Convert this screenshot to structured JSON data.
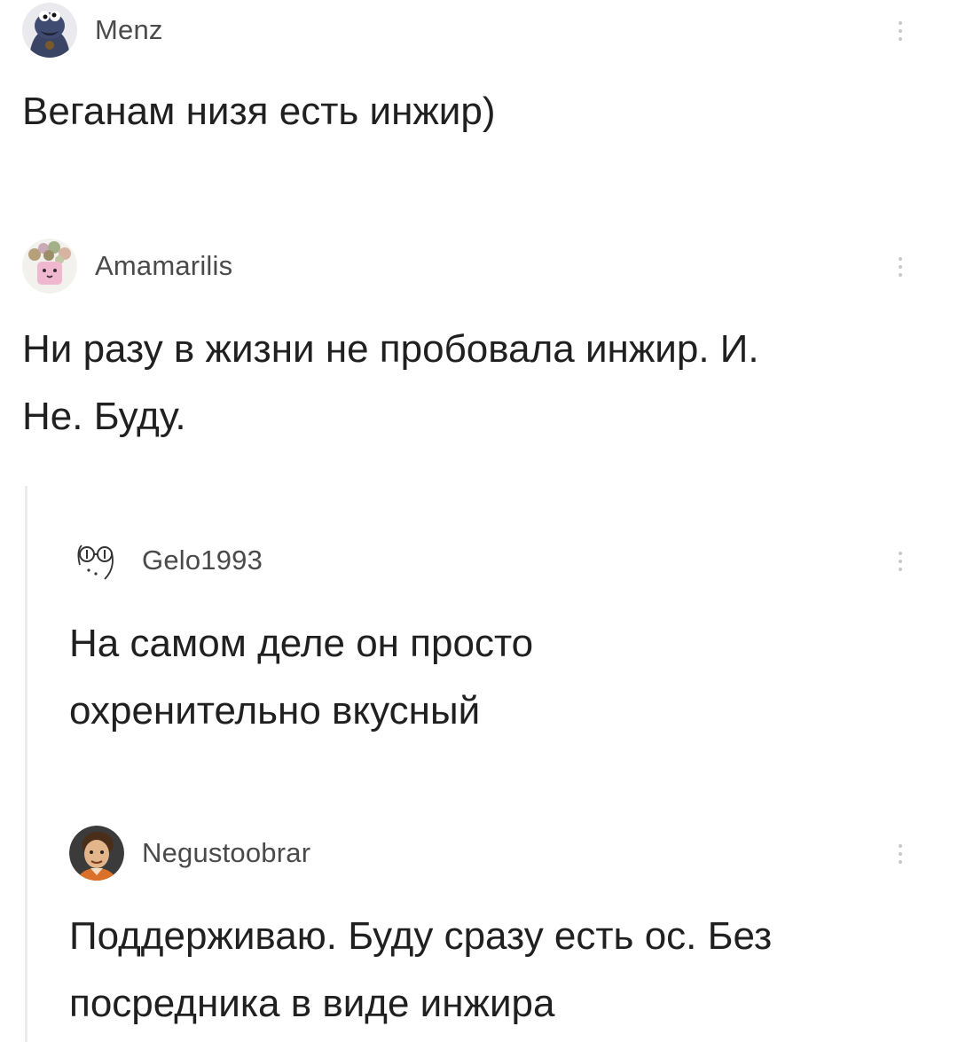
{
  "comments": [
    {
      "username": "Menz",
      "avatar_icon": "cookie-monster-avatar",
      "text": "Веганам низя есть инжир)"
    },
    {
      "username": "Amamarilis",
      "avatar_icon": "flower-cup-avatar",
      "text": "Ни разу в жизни не пробовала инжир. И.\nНе. Буду."
    },
    {
      "username": "Gelo1993",
      "avatar_icon": "glasses-face-avatar",
      "text": "На самом деле он просто\nохренительно вкусный"
    },
    {
      "username": "Negustoobrar",
      "avatar_icon": "cartoon-man-avatar",
      "text": "Поддерживаю. Буду сразу есть ос. Без\nпосредника в виде инжира"
    }
  ],
  "colors": {
    "username": "#4a4a4a",
    "text": "#202020",
    "more_dots": "#c8c8c8",
    "thread_line": "#ececec"
  },
  "more_icon": "vertical-ellipsis-icon"
}
